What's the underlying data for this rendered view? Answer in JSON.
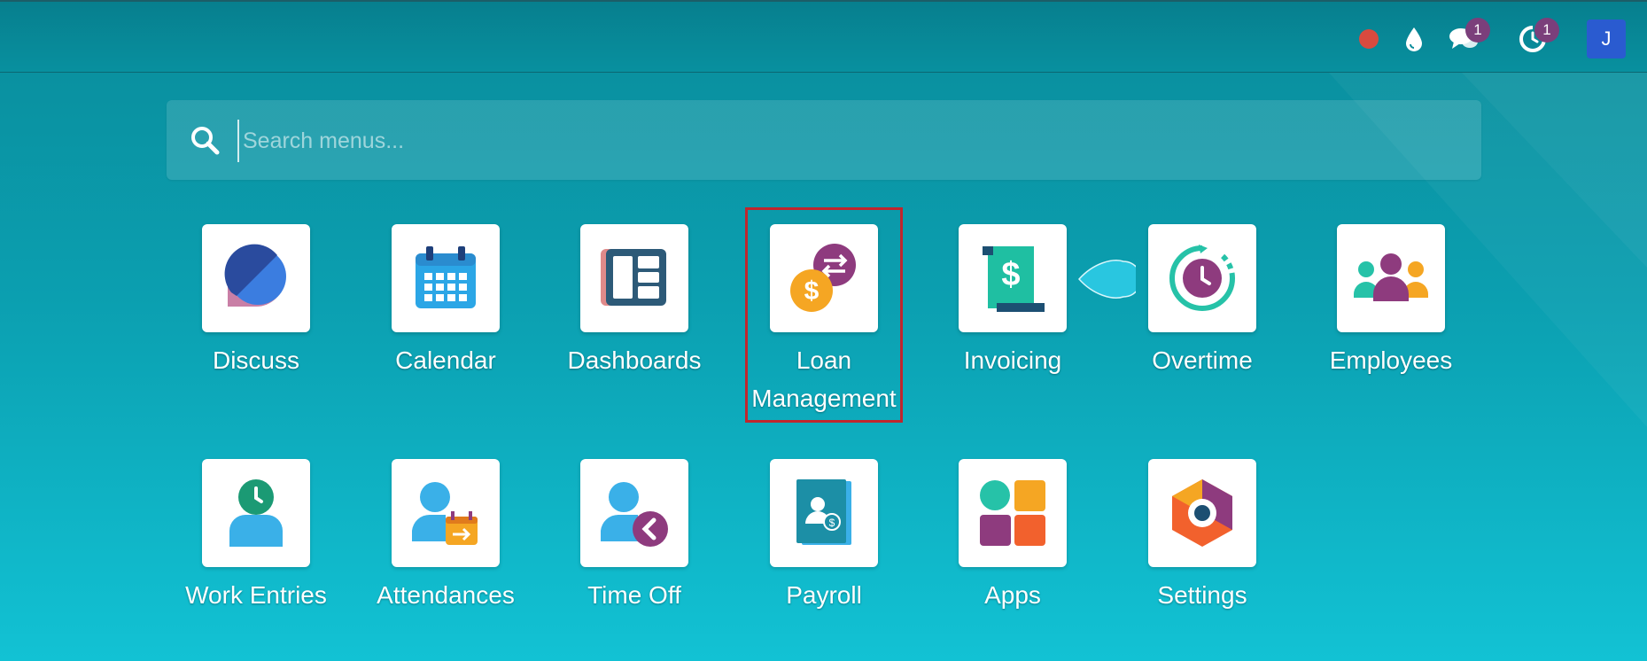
{
  "topbar": {
    "status_color": "#d94a3f",
    "messages_count": "1",
    "activities_count": "1",
    "user_initial": "J"
  },
  "search": {
    "placeholder": "Search menus..."
  },
  "apps": [
    {
      "label": "Discuss",
      "icon": "discuss-icon"
    },
    {
      "label": "Calendar",
      "icon": "calendar-icon"
    },
    {
      "label": "Dashboards",
      "icon": "dashboards-icon"
    },
    {
      "label": "Loan Management",
      "icon": "loan-management-icon"
    },
    {
      "label": "Invoicing",
      "icon": "invoicing-icon"
    },
    {
      "label": "Overtime",
      "icon": "overtime-icon"
    },
    {
      "label": "Employees",
      "icon": "employees-icon"
    },
    {
      "label": "Work Entries",
      "icon": "work-entries-icon"
    },
    {
      "label": "Attendances",
      "icon": "attendances-icon"
    },
    {
      "label": "Time Off",
      "icon": "time-off-icon"
    },
    {
      "label": "Payroll",
      "icon": "payroll-icon"
    },
    {
      "label": "Apps",
      "icon": "apps-icon"
    },
    {
      "label": "Settings",
      "icon": "settings-icon"
    }
  ]
}
